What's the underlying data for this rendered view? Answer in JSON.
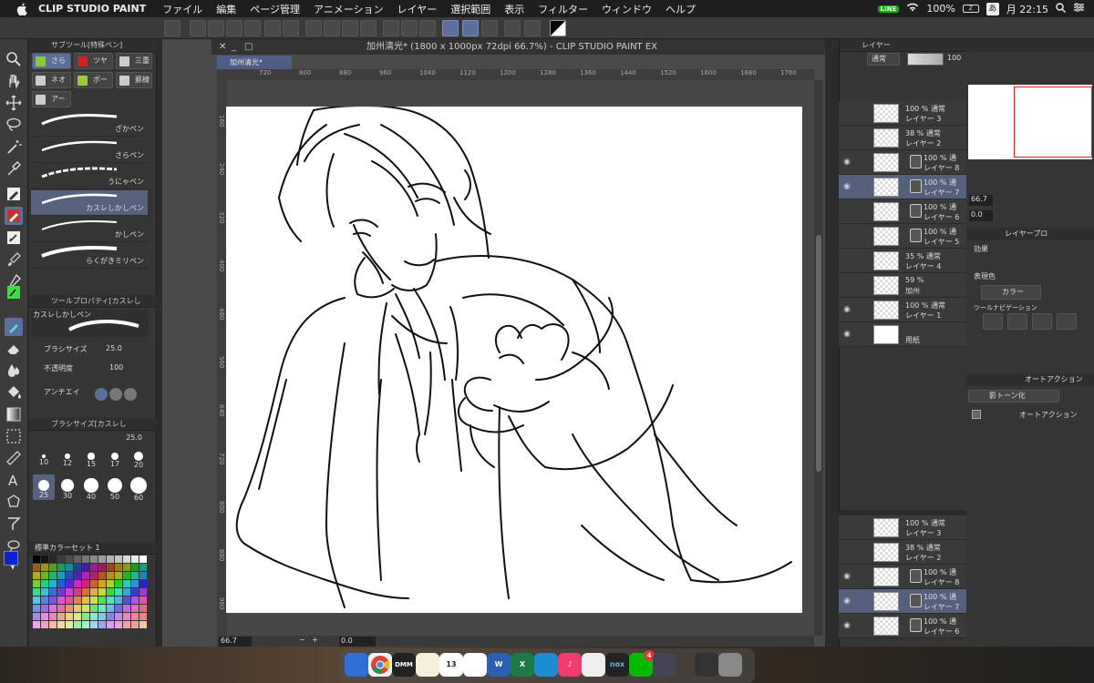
{
  "menubar": {
    "app_name": "CLIP STUDIO PAINT",
    "items": [
      "ファイル",
      "編集",
      "ページ管理",
      "アニメーション",
      "レイヤー",
      "選択範囲",
      "表示",
      "フィルター",
      "ウィンドウ",
      "ヘルプ"
    ],
    "battery": "100%",
    "battery_icon_text": "Z",
    "ime": "あ",
    "clock": "月 22:15"
  },
  "canvas": {
    "window_title": "加州清光* (1800 x 1000px 72dpi 66.7%)  - CLIP STUDIO PAINT EX",
    "doc_tab": "加州清光*",
    "ruler_h": [
      "720",
      "800",
      "880",
      "960",
      "1040",
      "1120",
      "1200",
      "1280",
      "1360",
      "1440",
      "1520",
      "1600",
      "1680",
      "1760"
    ],
    "ruler_v": [
      "160",
      "240",
      "320",
      "400",
      "480",
      "560",
      "640",
      "720",
      "800",
      "880",
      "960"
    ],
    "zoom": "66.7",
    "angle": "0.0"
  },
  "subtool": {
    "title": "サブツール[特殊ペン]",
    "groups": [
      "さら",
      "ツヤ",
      "三重",
      "ネオ",
      "ボー",
      "罫線",
      "アー"
    ],
    "group_colors": [
      "#8acb2a",
      "#d42020",
      "#cccccc",
      "#cccccc",
      "#9ccc3c",
      "#cccccc",
      "#cccccc"
    ],
    "brushes": [
      "ざかペン",
      "さらペン",
      "うにゃペン",
      "カスレしかしペン",
      "かしペン",
      "らくがきミリペン"
    ]
  },
  "tool_property": {
    "title": "ツールプロパティ[カスレし",
    "brush_name": "カスレしかしペン",
    "brush_size_label": "ブラシサイズ",
    "brush_size_value": "25.0",
    "opacity_label": "不透明度",
    "opacity_value": "100",
    "antialias_label": "アンチエイ"
  },
  "brush_size_panel": {
    "title": "ブラシサイズ[カスレし",
    "value": "25.0",
    "sizes": [
      "10",
      "12",
      "15",
      "17",
      "20",
      "25",
      "30",
      "40",
      "50",
      "60"
    ],
    "selected_size": "25"
  },
  "color_set": {
    "title": "標準カラーセット 1",
    "main_color": "#0a21d8",
    "sub_color": "#000000"
  },
  "layer_panel": {
    "title": "レイヤー",
    "blend": "通常",
    "opacity": "100",
    "layers": [
      {
        "pct": "100 % 通常",
        "name": "レイヤー 3",
        "visible": false
      },
      {
        "pct": "38 % 通常",
        "name": "レイヤー 2",
        "visible": false
      },
      {
        "pct": "100 % 通",
        "name": "レイヤー 8",
        "visible": true
      },
      {
        "pct": "100 % 通",
        "name": "レイヤー 7",
        "visible": true
      },
      {
        "pct": "100 % 通",
        "name": "レイヤー 6",
        "visible": false
      },
      {
        "pct": "100 % 通",
        "name": "レイヤー 5",
        "visible": false
      },
      {
        "pct": "35 % 通常",
        "name": "レイヤー 4",
        "visible": false
      },
      {
        "pct": "59 %",
        "name": "加州",
        "visible": false
      },
      {
        "pct": "100 % 通常",
        "name": "レイヤー 1",
        "visible": true
      },
      {
        "pct": "",
        "name": "用紙",
        "visible": true
      }
    ],
    "layers_dup": [
      {
        "pct": "100 % 通常",
        "name": "レイヤー 3"
      },
      {
        "pct": "38 % 通常",
        "name": "レイヤー 2"
      },
      {
        "pct": "100 % 通",
        "name": "レイヤー 8"
      },
      {
        "pct": "100 % 通",
        "name": "レイヤー 7"
      },
      {
        "pct": "100 % 通",
        "name": "レイヤー 6"
      }
    ]
  },
  "navigator": {
    "zoom": "66.7",
    "angle": "0.0"
  },
  "layer_property": {
    "title": "レイヤープロ",
    "effect_label": "効果",
    "expression_color_label": "表現色",
    "expression_color_value": "カラー",
    "tool_nav_label": "ツールナビゲーション"
  },
  "auto_action": {
    "title": "オートアクション",
    "set_name": "影トーン化",
    "item": "オートアクション"
  },
  "dock": {
    "calendar_day": "13",
    "dmm_label": "DMM",
    "badge_count": "4"
  }
}
